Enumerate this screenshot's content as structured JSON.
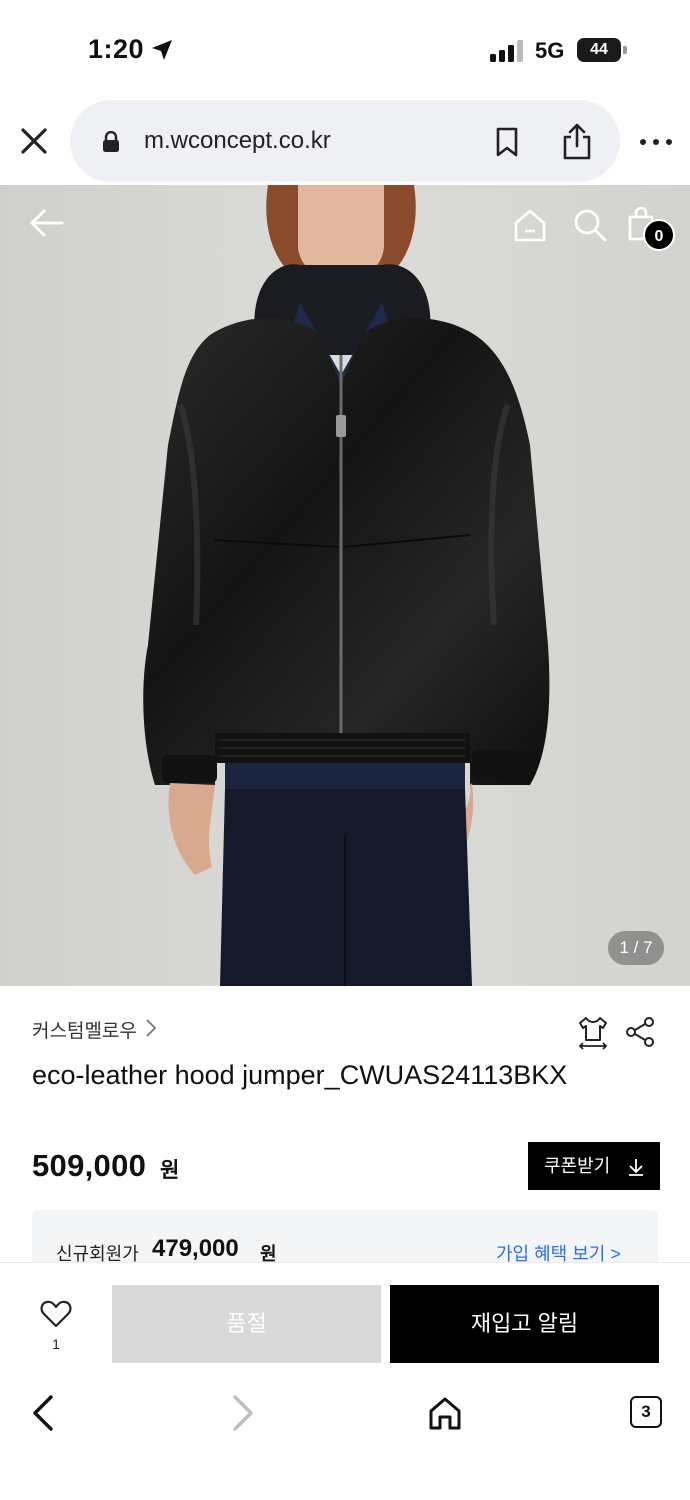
{
  "status_bar": {
    "time": "1:20",
    "network": "5G",
    "battery": "44"
  },
  "browser": {
    "url": "m.wconcept.co.kr",
    "tab_count": "3"
  },
  "header": {
    "cart_count": "0"
  },
  "gallery": {
    "pager": "1 / 7"
  },
  "product": {
    "brand": "커스텀멜로우",
    "title": "eco-leather hood jumper_CWUAS24113BKX",
    "price": "509,000",
    "price_unit": "원",
    "coupon_label": "쿠폰받기"
  },
  "member_offer": {
    "label": "신규회원가",
    "price": "479,000",
    "unit": "원",
    "link": "가입 혜택 보기 >"
  },
  "actions": {
    "like_count": "1",
    "soldout_label": "품절",
    "restock_label": "재입고 알림"
  },
  "colors": {
    "accent_link": "#2a6df4",
    "primary_button": "#000000",
    "disabled_button": "#d9d9d9"
  },
  "icons": [
    "location-arrow-icon",
    "signal-icon",
    "lock-icon",
    "bookmark-icon",
    "share-icon",
    "more-icon",
    "back-arrow-icon",
    "home-icon",
    "search-icon",
    "shopping-bag-icon",
    "size-fit-icon",
    "share-nodes-icon",
    "heart-icon",
    "download-arrow-icon",
    "chevron-left-icon",
    "chevron-right-icon"
  ]
}
